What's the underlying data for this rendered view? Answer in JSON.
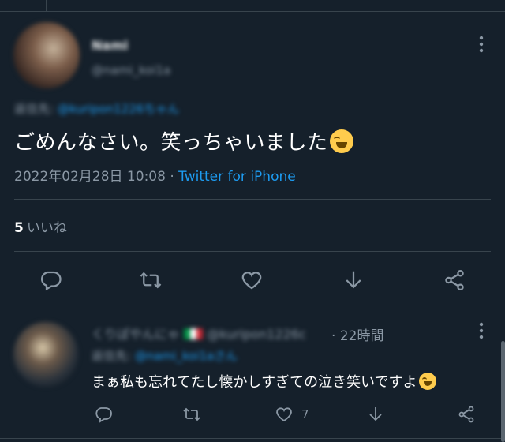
{
  "tweet": {
    "author_name": "Nami",
    "author_handle": "@nami_koi1a",
    "reply_to_prefix": "返信先:",
    "reply_to_mention": "@kuripon1226ちゃん",
    "text": "ごめんなさい。笑っちゃいました",
    "timestamp": "2022年02月28日 10:08",
    "separator": " · ",
    "source": "Twitter for iPhone",
    "likes_count": "5",
    "likes_label": "いいね"
  },
  "reply": {
    "author_name": "くりぽやんにゃ",
    "author_handle": "@kuripon1226c",
    "time_ago": "· 22時間",
    "reply_to_prefix": "返信先:",
    "reply_to_mention": "@nami_koi1aさん",
    "text": "まぁ私も忘れてたし懐かしすぎての泣き笑いですよ",
    "like_count": "7"
  },
  "colors": {
    "background": "#15202b",
    "secondary_text": "#8b98a5",
    "accent": "#1d9bf0",
    "divider": "#38444d"
  },
  "icons": [
    "more-icon",
    "reply-icon",
    "retweet-icon",
    "like-icon",
    "bookmark-icon",
    "share-icon"
  ]
}
